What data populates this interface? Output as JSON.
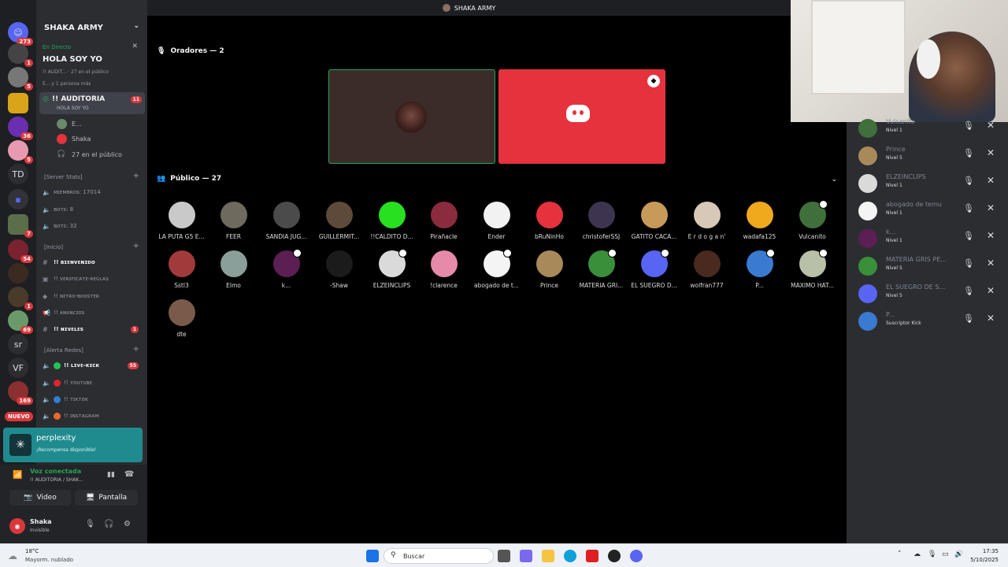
{
  "server": {
    "name": "SHAKA ARMY"
  },
  "rail_badges": [
    "273",
    "1",
    "5",
    "36",
    "5",
    "7",
    "54",
    "1",
    "69",
    "169"
  ],
  "rail_labels": {
    "td": "TD",
    "sr": "sr",
    "vf": "VF",
    "nuevo": "NUEVO"
  },
  "live": {
    "tag": "En Directo",
    "title": "HOLA SOY YO",
    "line1": "!! AUDIT... · 27 en el público",
    "line2": "E... y 1 persona más"
  },
  "stage_channel": {
    "name": "!! AUDITORIA",
    "subtitle": "HOLA SOY YO",
    "badge": "11"
  },
  "stage_members": [
    {
      "name": "E..."
    },
    {
      "name": "Shaka"
    },
    {
      "name": "27 en el público"
    }
  ],
  "categories": {
    "server_stats": "[Server Stats]",
    "inicio": "[Inicio]",
    "alerta": "[Alerta Redes]"
  },
  "stats": [
    "ᴍɪᴇᴍʙʀᴏs: 17014",
    "ʙᴏᴛs: 8",
    "ʙᴏᴛs: 32"
  ],
  "inicio_channels": [
    {
      "label": "!! ʙɪᴇɴᴠᴇɴɪᴅᴏ"
    },
    {
      "label": "!! ᴠᴇʀɪꜰɪᴄᴀᴛᴇ-ʀᴇɢʟᴀs"
    },
    {
      "label": "!! ɴɪᴛʀᴏ-ʙᴏᴏsᴛᴇʀ"
    },
    {
      "label": "!! ᴀɴᴜɴᴄɪᴏs"
    },
    {
      "label": "!! ɴɪᴠᴇʟᴇs",
      "badge": "1"
    }
  ],
  "alerta_channels": [
    {
      "label": "!! ʟɪᴠᴇ-ᴋɪᴄᴋ",
      "badge": "55",
      "color": "#23c552"
    },
    {
      "label": "!! ʏᴏᴜᴛᴜʙᴇ",
      "color": "#e0242b"
    },
    {
      "label": "!! ᴛɪᴋᴛᴏᴋ",
      "color": "#2e7fd4"
    },
    {
      "label": "!! ɪɴsᴛᴀɢʀᴀᴍ",
      "color": "#e86a2e"
    }
  ],
  "promo": {
    "title": "perplexity",
    "subtitle": "¡Recompensa disponible!"
  },
  "voice": {
    "title": "Voz conectada",
    "subtitle": "!! AUDITORIA / SHAK...",
    "video": "Video",
    "screen": "Pantalla"
  },
  "user": {
    "name": "Shaka",
    "status": "Invisible"
  },
  "topbar": {
    "title": "SHAKA ARMY"
  },
  "speakers_header": "Oradores — 2",
  "audience_header": "Público — 27",
  "audience": [
    {
      "name": "LA PUTA G5 E...",
      "color": "#c9c9c9"
    },
    {
      "name": "FEER",
      "color": "#6f6a5e"
    },
    {
      "name": "SANDIA JUG...",
      "color": "#4b4b4b"
    },
    {
      "name": "GUILLERMIT...",
      "color": "#5d4a3a"
    },
    {
      "name": "!!CALDITO D...",
      "color": "#27e020"
    },
    {
      "name": "Pirañacle",
      "color": "#8a2b3e"
    },
    {
      "name": "Ender",
      "color": "#f2f2f2"
    },
    {
      "name": "bRuNinHo",
      "color": "#e5323d"
    },
    {
      "name": "christoferSSJ",
      "color": "#3d3550"
    },
    {
      "name": "GATITO CACA...",
      "color": "#c79a5a"
    },
    {
      "name": "E r d o g a n'",
      "color": "#d8c8b8"
    },
    {
      "name": "wadafa125",
      "color": "#f0a81c"
    },
    {
      "name": "Vulcanito",
      "color": "#3f6f3a"
    },
    {
      "name": "Sstl3",
      "color": "#a13a3a"
    },
    {
      "name": "Elmo",
      "color": "#8a9f9a"
    },
    {
      "name": "k...",
      "color": "#5b1f54"
    },
    {
      "name": "-Shaw",
      "color": "#1b1b1b"
    },
    {
      "name": "ELZEINCLIPS",
      "color": "#dadada"
    },
    {
      "name": "!clarence",
      "color": "#e58aa8"
    },
    {
      "name": "abogado de t...",
      "color": "#f4f4f4"
    },
    {
      "name": "Prince",
      "color": "#a8895a"
    },
    {
      "name": "MATERIA GRI...",
      "color": "#3a8f3a"
    },
    {
      "name": "EL SUEGRO D...",
      "color": "#5865f2"
    },
    {
      "name": "wolfran777",
      "color": "#4a2a1e"
    },
    {
      "name": "P...",
      "color": "#3a7ad0"
    },
    {
      "name": "MAXIMO HAT...",
      "color": "#b8c0a8"
    },
    {
      "name": "dte",
      "color": "#7a5a4a"
    }
  ],
  "panel": [
    {
      "name": "Vulcanito",
      "level": "Nivel 1",
      "color": "#3f6f3a"
    },
    {
      "name": "Prince",
      "level": "Nivel 5",
      "color": "#a8895a"
    },
    {
      "name": "ELZEINCLIPS",
      "level": "Nivel 1",
      "color": "#dadada"
    },
    {
      "name": "abogado de temu",
      "level": "Nivel 1",
      "color": "#f4f4f4"
    },
    {
      "name": "k...",
      "level": "Nivel 1",
      "color": "#5b1f54"
    },
    {
      "name": "MATERIA GRIS PE...",
      "level": "Nivel 5",
      "color": "#3a8f3a"
    },
    {
      "name": "EL SUEGRO DE S...",
      "level": "Nivel 5",
      "color": "#5865f2"
    },
    {
      "name": "P...",
      "level": "Suscriptor Kick",
      "color": "#3a7ad0"
    }
  ],
  "taskbar": {
    "temp": "18°C",
    "weather": "Mayorm. nublado",
    "search": "Buscar",
    "time": "17:35",
    "date": "5/10/2025"
  }
}
